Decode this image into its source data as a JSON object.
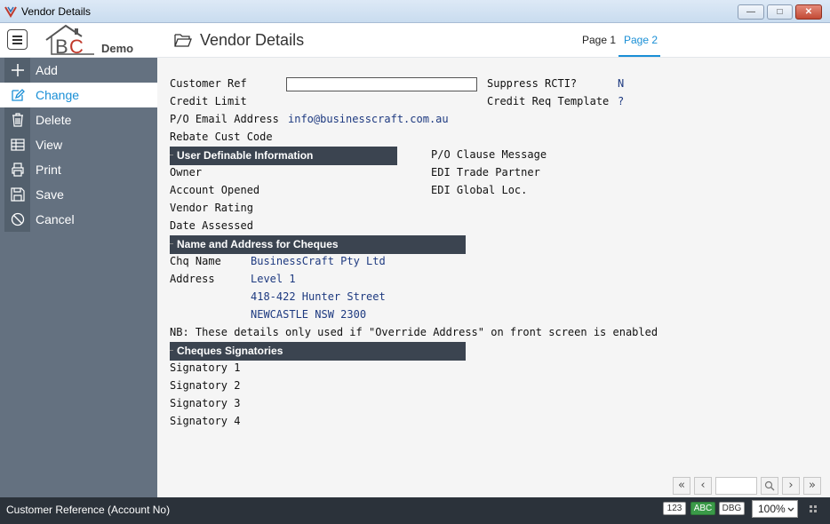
{
  "window": {
    "title": "Vendor Details"
  },
  "header": {
    "logo_text": "BC",
    "logo_demo": "Demo",
    "title": "Vendor Details",
    "tabs": [
      {
        "label": "Page 1"
      },
      {
        "label": "Page 2"
      }
    ],
    "active_tab": "Page 2"
  },
  "sidebar": {
    "items": [
      {
        "label": "Add",
        "icon": "plus-icon"
      },
      {
        "label": "Change",
        "icon": "edit-icon"
      },
      {
        "label": "Delete",
        "icon": "trash-icon"
      },
      {
        "label": "View",
        "icon": "table-icon"
      },
      {
        "label": "Print",
        "icon": "printer-icon"
      },
      {
        "label": "Save",
        "icon": "save-icon"
      },
      {
        "label": "Cancel",
        "icon": "cancel-icon"
      }
    ],
    "active": "Change"
  },
  "form": {
    "customer_ref": {
      "label": "Customer Ref",
      "value": ""
    },
    "credit_limit": {
      "label": "Credit Limit",
      "value": ""
    },
    "po_email": {
      "label": "P/O Email Address",
      "value": "info@businesscraft.com.au"
    },
    "rebate_cust_code": {
      "label": "Rebate Cust Code",
      "value": ""
    },
    "suppress_rcti": {
      "label": "Suppress RCTI?",
      "value": "N"
    },
    "credit_req_template": {
      "label": "Credit Req Template",
      "value": "?"
    },
    "po_clause_message": {
      "label": "P/O Clause Message"
    },
    "edi_trade_partner": {
      "label": "EDI Trade Partner"
    },
    "edi_global_loc": {
      "label": "EDI Global Loc."
    }
  },
  "sections": {
    "user_defined": "User Definable Information",
    "cheque_address": "Name and Address for Cheques",
    "signatories": "Cheques Signatories"
  },
  "user_defined": {
    "owner": "Owner",
    "account_opened": "Account Opened",
    "vendor_rating": "Vendor Rating",
    "date_assessed": "Date Assessed"
  },
  "cheque": {
    "name_label": "Chq Name",
    "name_value": "BusinessCraft Pty Ltd",
    "address_label": "Address",
    "address_lines": [
      "Level 1",
      "418-422 Hunter Street",
      "NEWCASTLE NSW 2300"
    ],
    "note": "NB: These details only used if \"Override Address\" on front screen is enabled"
  },
  "signatories": [
    "Signatory 1",
    "Signatory 2",
    "Signatory 3",
    "Signatory 4"
  ],
  "status": {
    "text": "Customer Reference (Account No)",
    "badge_123": "123",
    "badge_abc": "ABC",
    "badge_dbg": "DBG",
    "zoom": "100%"
  },
  "colors": {
    "accent": "#1a8fd6",
    "sidebar": "#647180",
    "section": "#3b4450",
    "status_bar": "#2b323a"
  }
}
